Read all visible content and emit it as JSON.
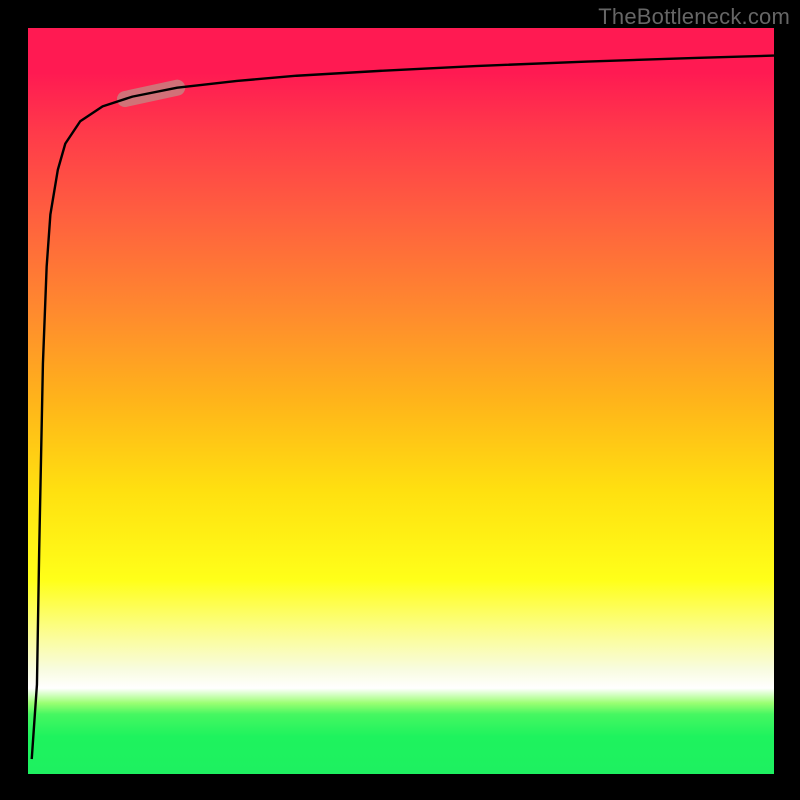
{
  "watermark": "TheBottleneck.com",
  "chart_data": {
    "type": "line",
    "title": "",
    "xlabel": "",
    "ylabel": "",
    "xlim": [
      0,
      100
    ],
    "ylim": [
      0,
      100
    ],
    "grid": false,
    "series": [
      {
        "name": "curve",
        "x": [
          0.5,
          1.2,
          1.5,
          2,
          2.5,
          3,
          4,
          5,
          7,
          10,
          14,
          20,
          28,
          36,
          48,
          60,
          75,
          90,
          100
        ],
        "y": [
          2,
          12,
          30,
          55,
          68,
          75,
          81,
          84.5,
          87.5,
          89.5,
          90.8,
          92.0,
          92.9,
          93.6,
          94.3,
          94.9,
          95.5,
          96.0,
          96.3
        ]
      }
    ],
    "highlight_segment": {
      "series": "curve",
      "x_start": 13,
      "x_end": 20,
      "color": "#c97f7f",
      "width": 16
    },
    "background_gradient": {
      "type": "vertical",
      "stops": [
        {
          "pos": 0.0,
          "color": "#ff1a52"
        },
        {
          "pos": 0.5,
          "color": "#ffb41a"
        },
        {
          "pos": 0.74,
          "color": "#ffff19"
        },
        {
          "pos": 0.88,
          "color": "#ffffff"
        },
        {
          "pos": 0.92,
          "color": "#46f761"
        },
        {
          "pos": 1.0,
          "color": "#1ef060"
        }
      ]
    }
  }
}
